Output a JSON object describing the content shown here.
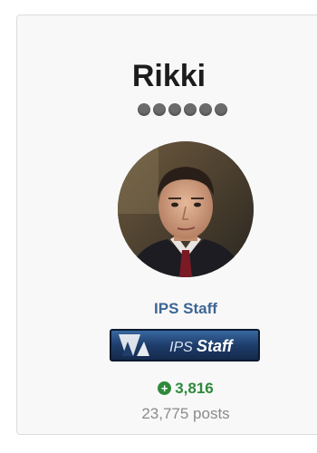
{
  "profile": {
    "name": "Rikki",
    "rank_pips": 6,
    "group_name": "IPS Staff",
    "badge_text_prefix": "IPS",
    "badge_text_suffix": "Staff",
    "reputation": "3,816",
    "posts": "23,775 posts"
  },
  "icons": {
    "rep": "plus-circle-icon",
    "pip": "rank-pip-icon"
  },
  "colors": {
    "group_name": "#3d6594",
    "reputation": "#2f8a3c",
    "posts": "#8a8a8a",
    "badge_bg": "#1e3d6b"
  }
}
